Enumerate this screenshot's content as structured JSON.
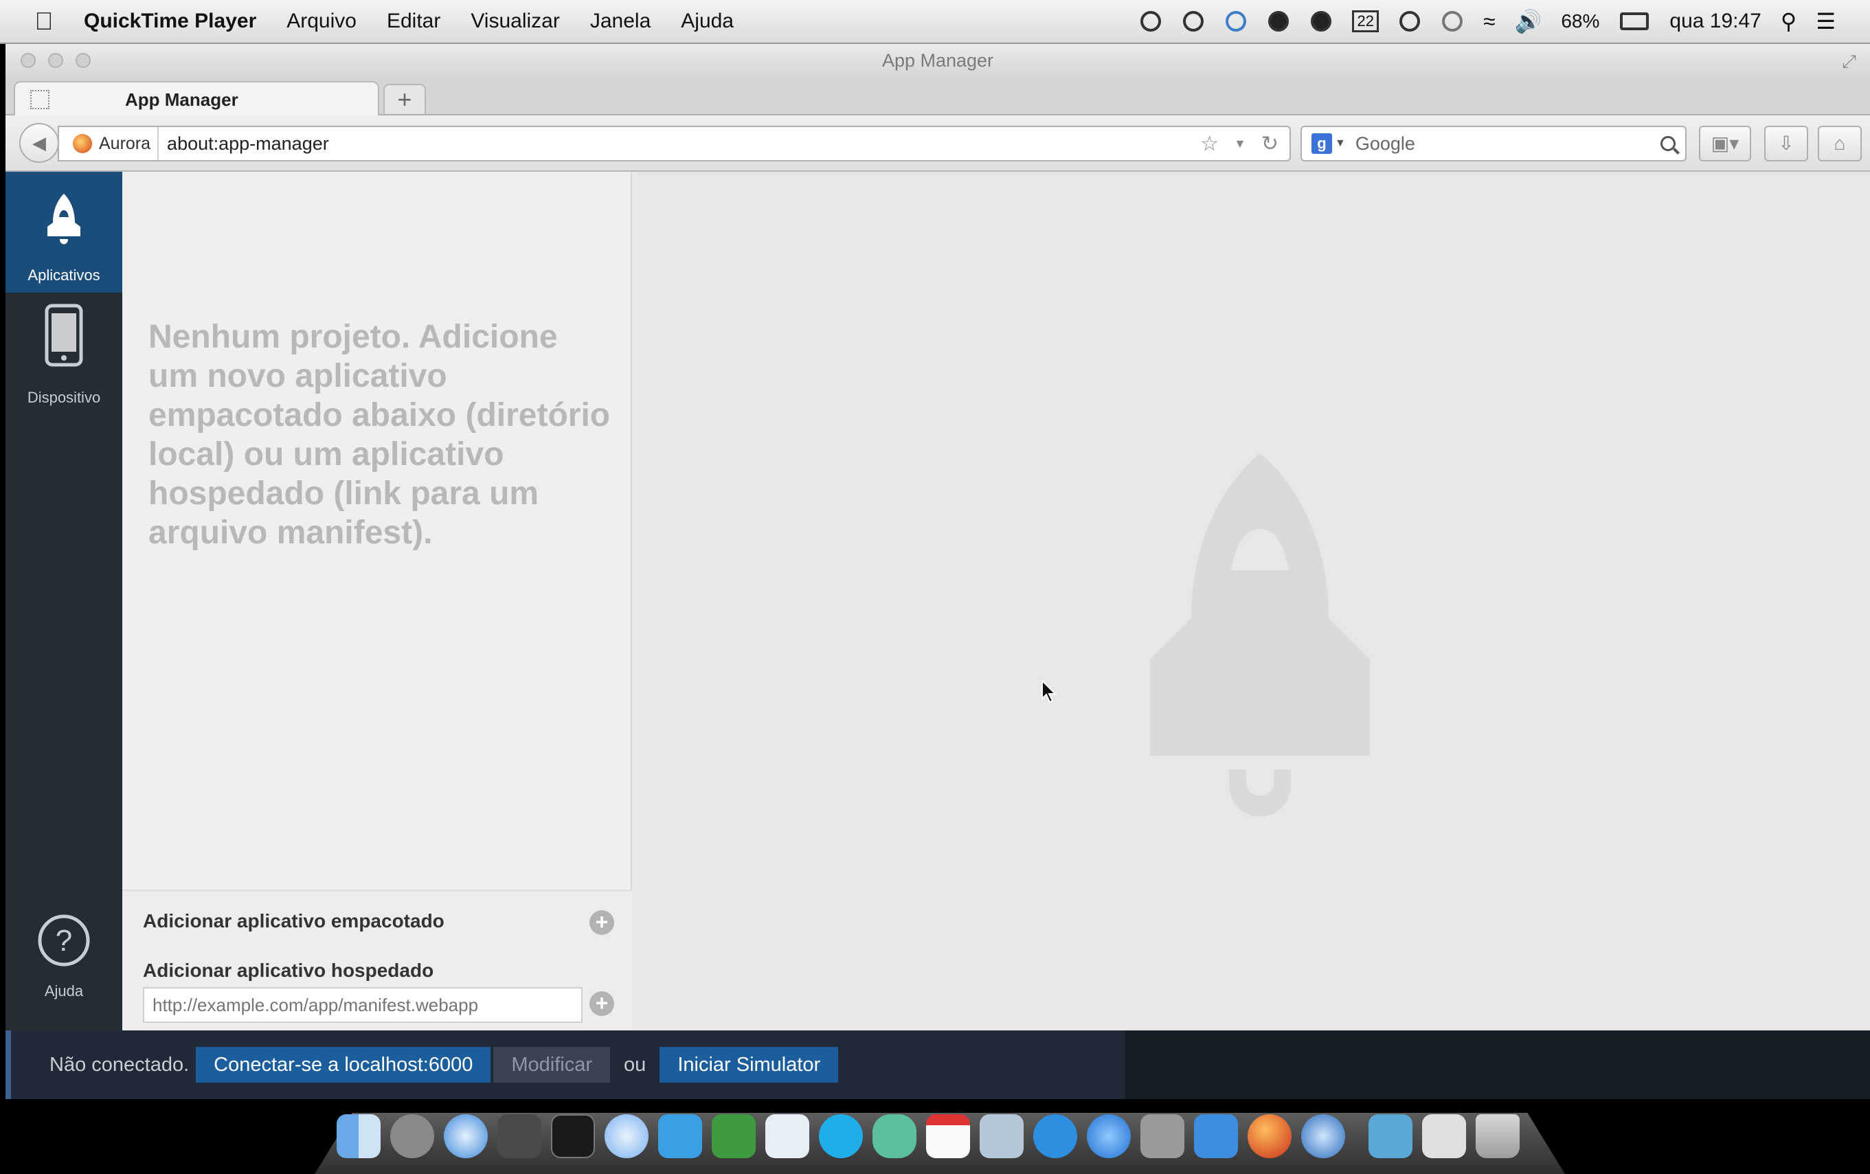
{
  "menubar": {
    "app_name": "QuickTime Player",
    "menus": [
      "Arquivo",
      "Editar",
      "Visualizar",
      "Janela",
      "Ajuda"
    ],
    "battery": "68%",
    "calendar_day": "22",
    "clock": "qua 19:47"
  },
  "window": {
    "title": "App Manager",
    "tab_label": "App Manager",
    "new_tab": "+"
  },
  "navbar": {
    "identity": "Aurora",
    "url": "about:app-manager",
    "search_placeholder": "Google"
  },
  "sidebar": {
    "items": [
      {
        "label": "Aplicativos",
        "icon": "rocket-icon",
        "active": true
      },
      {
        "label": "Dispositivo",
        "icon": "phone-icon",
        "active": false
      },
      {
        "label": "Ajuda",
        "icon": "help-icon",
        "active": false
      }
    ]
  },
  "projects": {
    "empty_message": "Nenhum projeto. Adicione um novo aplicativo empacotado abaixo (diretório local) ou um aplicativo hospedado (link para um arquivo manifest).",
    "add_packaged": "Adicionar aplicativo empacotado",
    "add_hosted": "Adicionar aplicativo hospedado",
    "hosted_placeholder": "http://example.com/app/manifest.webapp"
  },
  "statusbar": {
    "status": "Não conectado.",
    "connect_button": "Conectar-se a localhost:6000",
    "modify_button": "Modificar",
    "or": "ou",
    "simulator_button": "Iniciar Simulator"
  },
  "colors": {
    "sidebar_bg": "#252c33",
    "sidebar_active": "#1b4d7a",
    "primary_button": "#1b5e9b"
  }
}
